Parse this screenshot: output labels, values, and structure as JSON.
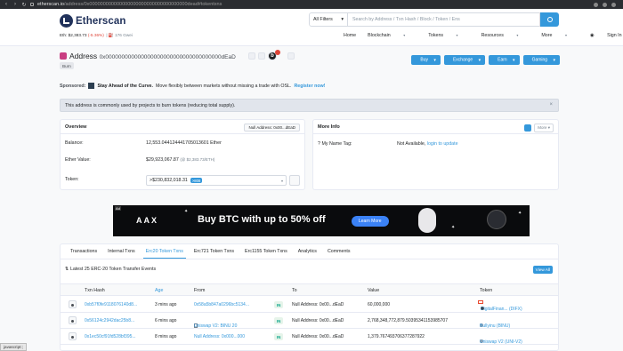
{
  "browser": {
    "url_host": "etherscan.io",
    "url_path": "/address/0x000000000000000000000000000000000000dead#tokentxns"
  },
  "header": {
    "logo_text": "Etherscan",
    "eth_price_label": "Eth: $2,383.73",
    "eth_price_change": "(-5.36%)",
    "gas": "176 Gwei",
    "filter_label": "All Filters",
    "search_placeholder": "Search by Address / Txn Hash / Block / Token / Ens",
    "menu": [
      "Home",
      "Blockchain",
      "Tokens",
      "Resources",
      "More",
      "Sign In"
    ]
  },
  "address": {
    "title": "Address",
    "hash": "0x000000000000000000000000000000000000dEaD",
    "tag": "Burn",
    "buttons": [
      "Buy",
      "Exchange",
      "Earn",
      "Gaming"
    ]
  },
  "sponsored": {
    "label": "Sponsored:",
    "headline": "Stay Ahead of the Curve.",
    "text": "Move flexibly between markets without missing a trade with OSL.",
    "cta": "Register now!"
  },
  "notice": "This address is commonly used by projects to burn tokens (reducing total supply).",
  "overview": {
    "title": "Overview",
    "null_tag": "Null Address: 0x00...dEaD",
    "balance_label": "Balance:",
    "balance_value": "12,553.044124441705013601 Ether",
    "ether_value_label": "Ether Value:",
    "ether_value": "$29,923,067.87",
    "ether_value_sub": "(@ $2,383.73/ETH)",
    "token_label": "Token:",
    "token_value": ">$230,832,018.31",
    "token_count": ">808"
  },
  "more_info": {
    "title": "More Info",
    "more_label": "More",
    "tag_label": "My Name Tag:",
    "tag_value": "Not Available,",
    "tag_link": "login to update"
  },
  "banner": {
    "ad_label": "Ad",
    "brand": "AAX",
    "message": "Buy BTC with up to 50% off",
    "cta": "Learn More"
  },
  "tabs": [
    "Transactions",
    "Internal Txns",
    "Erc20 Token Txns",
    "Erc721 Token Txns",
    "Erc1155 Token Txns",
    "Analytics",
    "Comments"
  ],
  "table": {
    "latest_text": "Latest 25 ERC-20 Token Transfer Events",
    "view_all": "View All",
    "headers": [
      "Txn Hash",
      "Age",
      "From",
      "To",
      "Value",
      "Token"
    ],
    "rows": [
      {
        "hash": "0xb57f0fe9118076140d8...",
        "age": "3 mins ago",
        "from": "0x58a5b847a0296bc5134...",
        "dir": "IN",
        "to": "Null Address: 0x00...dEaD",
        "value": "60,000,000",
        "token": "DigitalFinan... (DIFX)",
        "token_color": "#3a3a3a"
      },
      {
        "hash": "0x56124c2942dac25b8...",
        "age": "6 mins ago",
        "from": "Uniswap V2: BINU 20",
        "dir": "IN",
        "to": "Null Address: 0x00...dEaD",
        "value": "2,768,348,772,879.50395341153985707",
        "token": "Bullyinu (BINU)",
        "token_color": "#9aa4b0"
      },
      {
        "hash": "0x1ec50cf91fd528bf395...",
        "age": "8 mins ago",
        "from": "Null Address: 0x000...000",
        "dir": "IN",
        "to": "Null Address: 0x00...dEaD",
        "value": "1,379.767493706377287922",
        "token": "Uniswap V2 (UNI-V2)",
        "token_color": "#9aa4b0"
      }
    ]
  },
  "status_tip": "javascript:;"
}
